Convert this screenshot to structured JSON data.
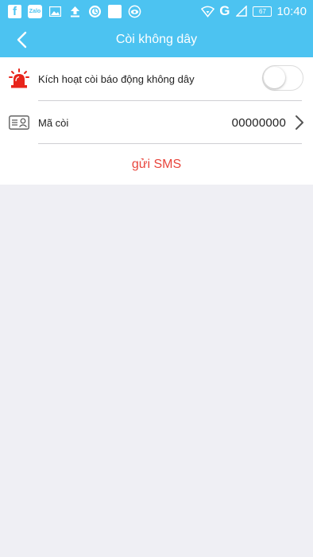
{
  "status_bar": {
    "time": "10:40",
    "network": "G",
    "battery": "67",
    "notification_icons": [
      "facebook-icon",
      "zalo-icon",
      "image-icon",
      "upload-icon",
      "app-circle-icon",
      "blank-square-icon",
      "eye-icon"
    ],
    "zalo_label": "Zalo"
  },
  "header": {
    "title": "Còi không dây",
    "background": "#4cc3f1"
  },
  "settings": {
    "enable_label": "Kích hoạt còi báo động không dây",
    "enable_state": false,
    "code_label": "Mã còi",
    "code_value": "00000000"
  },
  "actions": {
    "send_sms": "gửi SMS",
    "send_sms_color": "#e8453c"
  }
}
